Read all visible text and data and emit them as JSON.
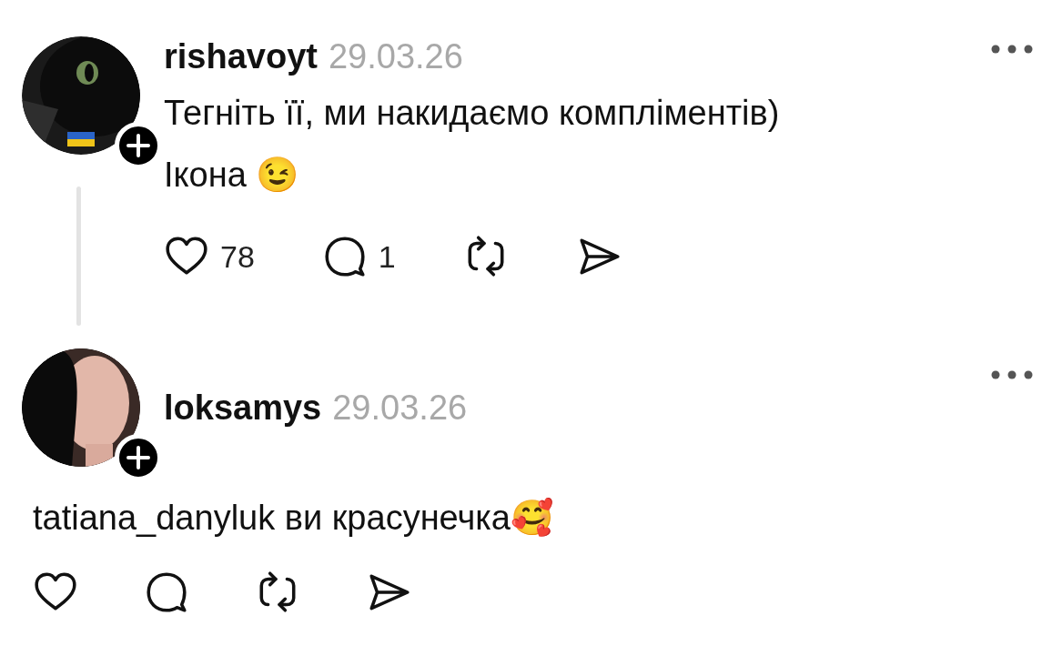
{
  "comments": [
    {
      "username": "rishavoyt",
      "date": "29.03.26",
      "kind": "inline",
      "thread_line": true,
      "lines": [
        "Тегніть її, ми накидаємо компліментів)",
        "Ікона 😉"
      ],
      "likes": "78",
      "replies": "1"
    },
    {
      "username": "loksamys",
      "date": "29.03.26",
      "kind": "wide",
      "thread_line": false,
      "lines": [
        "tatiana_danyluk ви красунечка🥰"
      ]
    }
  ]
}
